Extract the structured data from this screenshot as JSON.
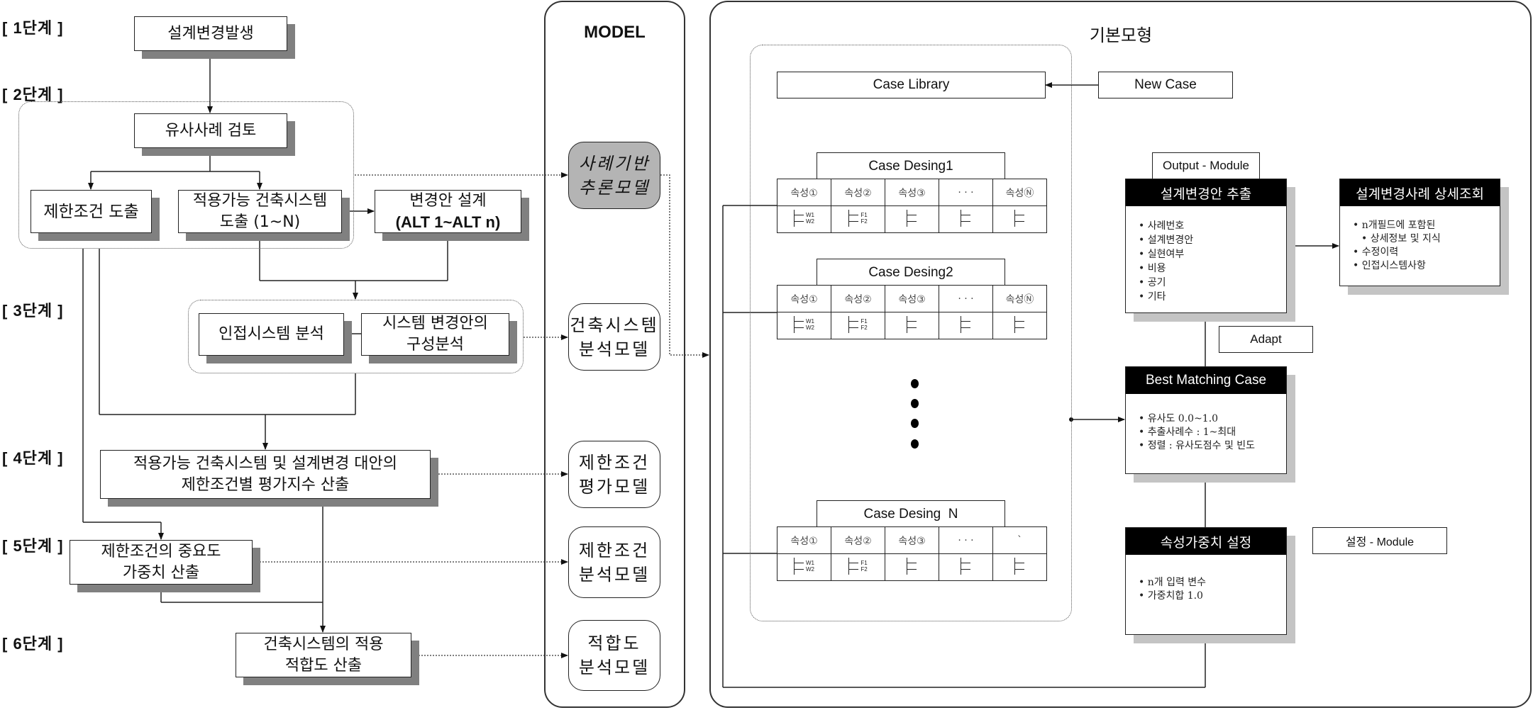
{
  "steps": {
    "s1": "[ 1단계 ]",
    "s2": "[ 2단계 ]",
    "s3": "[ 3단계 ]",
    "s4": "[ 4단계 ]",
    "s5": "[ 5단계 ]",
    "s6": "[ 6단계 ]"
  },
  "flow": {
    "design_change": "설계변경발생",
    "similar_review": "유사사례 검토",
    "constraint_derive": "제한조건 도출",
    "system_derive_l1": "적용가능 건축시스템",
    "system_derive_l2": "도출 (1~N)",
    "alt_design_l1": "변경안 설계",
    "alt_design_l2": "(ALT 1~ALT n)",
    "adjacent_analysis": "인접시스템 분석",
    "config_analysis_l1": "시스템 변경안의",
    "config_analysis_l2": "구성분석",
    "eval_index_l1": "적용가능 건축시스템 및 설계변경 대안의",
    "eval_index_l2": "제한조건별 평가지수 산출",
    "weight_l1": "제한조건의 중요도",
    "weight_l2": "가중치 산출",
    "suitability_l1": "건축시스템의 적용",
    "suitability_l2": "적합도 산출"
  },
  "model": {
    "title": "MODEL",
    "boxes": [
      {
        "l1": "사례기반",
        "l2": "추론모델"
      },
      {
        "l1": "건축시스템",
        "l2": "분석모델"
      },
      {
        "l1": "제한조건",
        "l2": "평가모델"
      },
      {
        "l1": "제한조건",
        "l2": "분석모델"
      },
      {
        "l1": "적합도",
        "l2": "분석모델"
      }
    ]
  },
  "basic": {
    "title": "기본모형",
    "case_library": "Case Library",
    "new_case": "New Case",
    "case_designs": [
      {
        "title": "Case Desing1",
        "attrs": [
          "속성①",
          "속성②",
          "속성③",
          "· · ·",
          "속성Ⓝ"
        ]
      },
      {
        "title": "Case Desing2",
        "attrs": [
          "속성①",
          "속성②",
          "속성③",
          "· · ·",
          "속성Ⓝ"
        ]
      },
      {
        "title": "Case Desing  N",
        "attrs": [
          "속성①",
          "속성②",
          "속성③",
          "· · ·",
          "`"
        ]
      }
    ],
    "flag_labels": {
      "w1": "W1",
      "w2": "W2",
      "f1": "F1",
      "f2": "F2"
    },
    "output_module_tag": "Output - Module",
    "extract": {
      "title": "설계변경안 추출",
      "items": [
        "사례번호",
        "설계변경안",
        "실현여부",
        "비용",
        "공기",
        "기타"
      ]
    },
    "detail": {
      "title": "설계변경사례 상세조회",
      "items": [
        "n개필드에 포함된",
        "상세정보 및 지식",
        "수정이력",
        "인접시스템사항"
      ]
    },
    "adapt": "Adapt",
    "best": {
      "title": "Best Matching Case",
      "items": [
        "유사도 0.0~1.0",
        "추출사례수 : 1~최대",
        "정렬 : 유사도점수 및 빈도"
      ]
    },
    "weight": {
      "title": "속성가중치 설정",
      "items": [
        "n개 입력 변수",
        "가중치합 1.0"
      ]
    },
    "setting_module_tag": "설정 - Module"
  }
}
